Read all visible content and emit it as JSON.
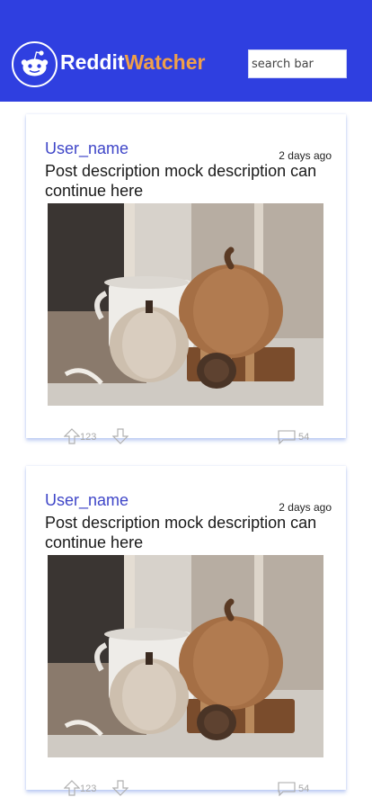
{
  "header": {
    "brand_part1": "Reddit",
    "brand_part2": "Watcher",
    "search_placeholder": "search bar",
    "logo_icon": "reddit-alien-icon",
    "colors": {
      "header_bg": "#2f3fe0",
      "brand_accent": "#f0a04a",
      "username": "#3f46c8"
    }
  },
  "posts": [
    {
      "username": "User_name",
      "timestamp": "2 days ago",
      "description": "Post description mock description can continue here",
      "image_icon": "pumpkins-photo",
      "upvotes": "123",
      "comments": "54"
    },
    {
      "username": "User_name",
      "timestamp": "2 days ago",
      "description": "Post description mock description can continue here",
      "image_icon": "pumpkins-photo",
      "upvotes": "123",
      "comments": "54"
    }
  ]
}
